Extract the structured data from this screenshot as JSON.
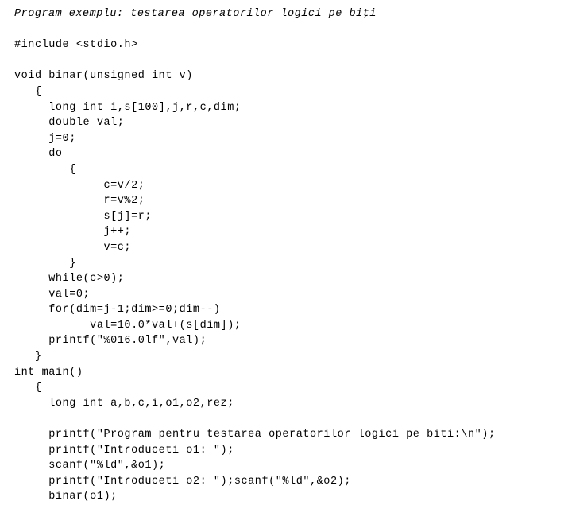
{
  "document": {
    "kind": "source-code-listing",
    "language": "C",
    "background_color": "#ffffff",
    "text_color": "#000000",
    "title": "Program exemplu: testarea operatorilor logici pe biţi"
  },
  "code": {
    "lines": [
      {
        "id": "l01",
        "text": "Program exemplu: testarea operatorilor logici pe biţi",
        "style": "title"
      },
      {
        "id": "l02",
        "text": "",
        "style": "blank"
      },
      {
        "id": "l03",
        "text": "#include <stdio.h>",
        "style": "code"
      },
      {
        "id": "l04",
        "text": "",
        "style": "blank"
      },
      {
        "id": "l05",
        "text": "void binar(unsigned int v)",
        "style": "code"
      },
      {
        "id": "l06",
        "text": "   {",
        "style": "code"
      },
      {
        "id": "l07",
        "text": "     long int i,s[100],j,r,c,dim;",
        "style": "code"
      },
      {
        "id": "l08",
        "text": "     double val;",
        "style": "code"
      },
      {
        "id": "l09",
        "text": "     j=0;",
        "style": "code"
      },
      {
        "id": "l10",
        "text": "     do",
        "style": "code"
      },
      {
        "id": "l11",
        "text": "        {",
        "style": "code"
      },
      {
        "id": "l12",
        "text": "             c=v/2;",
        "style": "code"
      },
      {
        "id": "l13",
        "text": "             r=v%2;",
        "style": "code"
      },
      {
        "id": "l14",
        "text": "             s[j]=r;",
        "style": "code"
      },
      {
        "id": "l15",
        "text": "             j++;",
        "style": "code"
      },
      {
        "id": "l16",
        "text": "             v=c;",
        "style": "code"
      },
      {
        "id": "l17",
        "text": "        }",
        "style": "code"
      },
      {
        "id": "l18",
        "text": "     while(c>0);",
        "style": "code"
      },
      {
        "id": "l19",
        "text": "     val=0;",
        "style": "code"
      },
      {
        "id": "l20",
        "text": "     for(dim=j-1;dim>=0;dim--)",
        "style": "code"
      },
      {
        "id": "l21",
        "text": "           val=10.0*val+(s[dim]);",
        "style": "code"
      },
      {
        "id": "l22",
        "text": "     printf(\"%016.0lf\",val);",
        "style": "code"
      },
      {
        "id": "l23",
        "text": "   }",
        "style": "code"
      },
      {
        "id": "l24",
        "text": "int main()",
        "style": "code"
      },
      {
        "id": "l25",
        "text": "   {",
        "style": "code"
      },
      {
        "id": "l26",
        "text": "     long int a,b,c,i,o1,o2,rez;",
        "style": "code"
      },
      {
        "id": "l27",
        "text": "",
        "style": "blank"
      },
      {
        "id": "l28",
        "text": "     printf(\"Program pentru testarea operatorilor logici pe biti:\\n\");",
        "style": "code"
      },
      {
        "id": "l29",
        "text": "     printf(\"Introduceti o1: \");",
        "style": "code"
      },
      {
        "id": "l30",
        "text": "     scanf(\"%ld\",&o1);",
        "style": "code"
      },
      {
        "id": "l31",
        "text": "     printf(\"Introduceti o2: \");scanf(\"%ld\",&o2);",
        "style": "code"
      },
      {
        "id": "l32",
        "text": "     binar(o1);",
        "style": "code"
      }
    ]
  }
}
